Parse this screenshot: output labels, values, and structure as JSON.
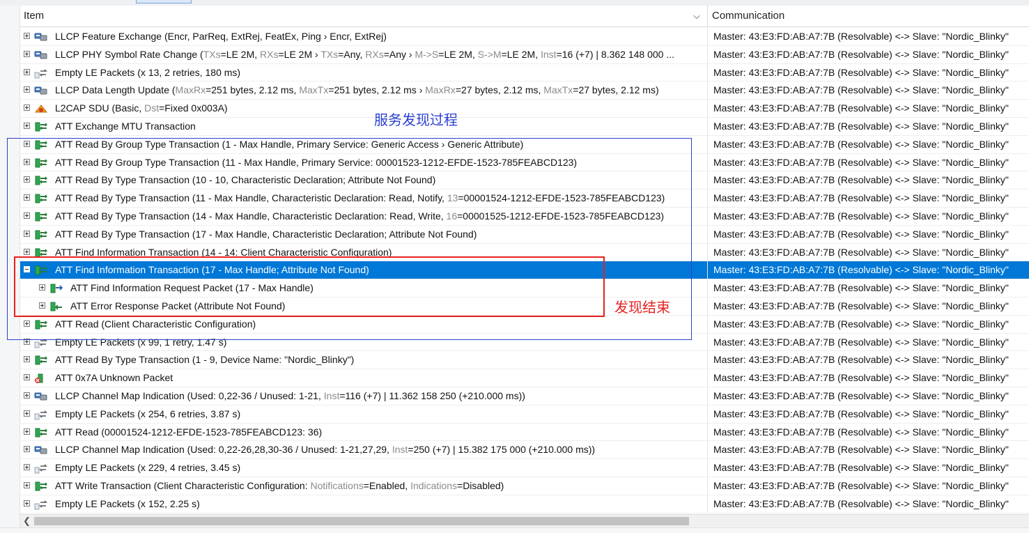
{
  "columns": {
    "item": "Item",
    "communication": "Communication"
  },
  "annotations": {
    "service_discovery": "服务发现过程",
    "discovery_end": "发现结束"
  },
  "colors": {
    "selection": "#0078d7",
    "annotation_blue": "#2a3fcf",
    "annotation_red": "#e52020"
  },
  "rows": [
    {
      "icon": "llcp-icon",
      "expander": "plus",
      "level": 0,
      "selected": false,
      "parts": [
        {
          "t": "LLCP Feature Exchange (Encr, ParReq, ExtRej, FeatEx, Ping › Encr, ExtRej)",
          "dim": false
        }
      ],
      "comm": "Master: 43:E3:FD:AB:A7:7B (Resolvable) <-> Slave: \"Nordic_Blinky\""
    },
    {
      "icon": "llcp-icon",
      "expander": "plus",
      "level": 0,
      "selected": false,
      "parts": [
        {
          "t": "LLCP PHY Symbol Rate Change (",
          "dim": false
        },
        {
          "t": "TXs",
          "dim": true
        },
        {
          "t": "=LE 2M, ",
          "dim": false
        },
        {
          "t": "RXs",
          "dim": true
        },
        {
          "t": "=LE 2M › ",
          "dim": false
        },
        {
          "t": "TXs",
          "dim": true
        },
        {
          "t": "=Any, ",
          "dim": false
        },
        {
          "t": "RXs",
          "dim": true
        },
        {
          "t": "=Any › ",
          "dim": false
        },
        {
          "t": "M->S",
          "dim": true
        },
        {
          "t": "=LE 2M, ",
          "dim": false
        },
        {
          "t": "S->M",
          "dim": true
        },
        {
          "t": "=LE 2M, ",
          "dim": false
        },
        {
          "t": "Inst",
          "dim": true
        },
        {
          "t": "=16 (+7) | 8.362 148 000 ...",
          "dim": false
        }
      ],
      "comm": "Master: 43:E3:FD:AB:A7:7B (Resolvable) <-> Slave: \"Nordic_Blinky\""
    },
    {
      "icon": "empty-packets-icon",
      "expander": "plus",
      "level": 0,
      "selected": false,
      "parts": [
        {
          "t": "Empty LE Packets (x 13, 2 retries, 180 ms)",
          "dim": false
        }
      ],
      "comm": "Master: 43:E3:FD:AB:A7:7B (Resolvable) <-> Slave: \"Nordic_Blinky\""
    },
    {
      "icon": "llcp-icon",
      "expander": "plus",
      "level": 0,
      "selected": false,
      "parts": [
        {
          "t": "LLCP Data Length Update (",
          "dim": false
        },
        {
          "t": "MaxRx",
          "dim": true
        },
        {
          "t": "=251 bytes, 2.12 ms, ",
          "dim": false
        },
        {
          "t": "MaxTx",
          "dim": true
        },
        {
          "t": "=251 bytes, 2.12 ms › ",
          "dim": false
        },
        {
          "t": "MaxRx",
          "dim": true
        },
        {
          "t": "=27 bytes, 2.12 ms, ",
          "dim": false
        },
        {
          "t": "MaxTx",
          "dim": true
        },
        {
          "t": "=27 bytes, 2.12 ms)",
          "dim": false
        }
      ],
      "comm": "Master: 43:E3:FD:AB:A7:7B (Resolvable) <-> Slave: \"Nordic_Blinky\""
    },
    {
      "icon": "l2cap-icon",
      "expander": "plus",
      "level": 0,
      "selected": false,
      "parts": [
        {
          "t": "L2CAP SDU (Basic, ",
          "dim": false
        },
        {
          "t": "Dst",
          "dim": true
        },
        {
          "t": "=Fixed 0x003A)",
          "dim": false
        }
      ],
      "comm": "Master: 43:E3:FD:AB:A7:7B (Resolvable) <-> Slave: \"Nordic_Blinky\""
    },
    {
      "icon": "att-transaction-icon",
      "expander": "plus",
      "level": 0,
      "selected": false,
      "parts": [
        {
          "t": "ATT Exchange MTU Transaction",
          "dim": false
        }
      ],
      "comm": "Master: 43:E3:FD:AB:A7:7B (Resolvable) <-> Slave: \"Nordic_Blinky\""
    },
    {
      "icon": "att-transaction-icon",
      "expander": "plus",
      "level": 0,
      "selected": false,
      "parts": [
        {
          "t": "ATT Read By Group Type Transaction (1 - Max Handle, Primary Service:  Generic Access › Generic Attribute)",
          "dim": false
        }
      ],
      "comm": "Master: 43:E3:FD:AB:A7:7B (Resolvable) <-> Slave: \"Nordic_Blinky\""
    },
    {
      "icon": "att-transaction-icon",
      "expander": "plus",
      "level": 0,
      "selected": false,
      "parts": [
        {
          "t": "ATT Read By Group Type Transaction (11 - Max Handle, Primary Service: 00001523-1212-EFDE-1523-785FEABCD123)",
          "dim": false
        }
      ],
      "comm": "Master: 43:E3:FD:AB:A7:7B (Resolvable) <-> Slave: \"Nordic_Blinky\""
    },
    {
      "icon": "att-transaction-icon",
      "expander": "plus",
      "level": 0,
      "selected": false,
      "parts": [
        {
          "t": "ATT Read By Type Transaction (10 - 10, Characteristic Declaration; Attribute Not Found)",
          "dim": false
        }
      ],
      "comm": "Master: 43:E3:FD:AB:A7:7B (Resolvable) <-> Slave: \"Nordic_Blinky\""
    },
    {
      "icon": "att-transaction-icon",
      "expander": "plus",
      "level": 0,
      "selected": false,
      "parts": [
        {
          "t": "ATT Read By Type Transaction (11 - Max Handle, Characteristic Declaration: Read, Notify, ",
          "dim": false
        },
        {
          "t": "13",
          "dim": true
        },
        {
          "t": "=00001524-1212-EFDE-1523-785FEABCD123)",
          "dim": false
        }
      ],
      "comm": "Master: 43:E3:FD:AB:A7:7B (Resolvable) <-> Slave: \"Nordic_Blinky\""
    },
    {
      "icon": "att-transaction-icon",
      "expander": "plus",
      "level": 0,
      "selected": false,
      "parts": [
        {
          "t": "ATT Read By Type Transaction (14 - Max Handle, Characteristic Declaration: Read, Write, ",
          "dim": false
        },
        {
          "t": "16",
          "dim": true
        },
        {
          "t": "=00001525-1212-EFDE-1523-785FEABCD123)",
          "dim": false
        }
      ],
      "comm": "Master: 43:E3:FD:AB:A7:7B (Resolvable) <-> Slave: \"Nordic_Blinky\""
    },
    {
      "icon": "att-transaction-icon",
      "expander": "plus",
      "level": 0,
      "selected": false,
      "parts": [
        {
          "t": "ATT Read By Type Transaction (17 - Max Handle, Characteristic Declaration; Attribute Not Found)",
          "dim": false
        }
      ],
      "comm": "Master: 43:E3:FD:AB:A7:7B (Resolvable) <-> Slave: \"Nordic_Blinky\""
    },
    {
      "icon": "att-transaction-icon",
      "expander": "plus",
      "level": 0,
      "selected": false,
      "parts": [
        {
          "t": "ATT Find Information Transaction (14 - 14: Client Characteristic Configuration)",
          "dim": false
        }
      ],
      "comm": "Master: 43:E3:FD:AB:A7:7B (Resolvable) <-> Slave: \"Nordic_Blinky\""
    },
    {
      "icon": "att-transaction-icon",
      "expander": "minus",
      "level": 0,
      "selected": true,
      "parts": [
        {
          "t": "ATT Find Information Transaction (17 - Max Handle; Attribute Not Found)",
          "dim": false
        }
      ],
      "comm": "Master: 43:E3:FD:AB:A7:7B (Resolvable) <-> Slave: \"Nordic_Blinky\""
    },
    {
      "icon": "att-request-icon",
      "expander": "plus",
      "level": 1,
      "selected": false,
      "parts": [
        {
          "t": "ATT Find Information Request Packet (17 - Max Handle)",
          "dim": false
        }
      ],
      "comm": "Master: 43:E3:FD:AB:A7:7B (Resolvable) <-> Slave: \"Nordic_Blinky\""
    },
    {
      "icon": "att-response-icon",
      "expander": "plus",
      "level": 1,
      "selected": false,
      "parts": [
        {
          "t": "ATT Error Response Packet (Attribute Not Found)",
          "dim": false
        }
      ],
      "comm": "Master: 43:E3:FD:AB:A7:7B (Resolvable) <-> Slave: \"Nordic_Blinky\""
    },
    {
      "icon": "att-transaction-icon",
      "expander": "plus",
      "level": 0,
      "selected": false,
      "parts": [
        {
          "t": "ATT Read (Client Characteristic Configuration)",
          "dim": false
        }
      ],
      "comm": "Master: 43:E3:FD:AB:A7:7B (Resolvable) <-> Slave: \"Nordic_Blinky\""
    },
    {
      "icon": "empty-packets-icon",
      "expander": "plus",
      "level": 0,
      "selected": false,
      "parts": [
        {
          "t": "Empty LE Packets (x 99, 1 retry, 1.47 s)",
          "dim": false
        }
      ],
      "comm": "Master: 43:E3:FD:AB:A7:7B (Resolvable) <-> Slave: \"Nordic_Blinky\""
    },
    {
      "icon": "att-transaction-icon",
      "expander": "plus",
      "level": 0,
      "selected": false,
      "parts": [
        {
          "t": "ATT Read By Type Transaction (1 - 9, Device Name: \"Nordic_Blinky\")",
          "dim": false
        }
      ],
      "comm": "Master: 43:E3:FD:AB:A7:7B (Resolvable) <-> Slave: \"Nordic_Blinky\""
    },
    {
      "icon": "att-unknown-icon",
      "expander": "plus",
      "level": 0,
      "selected": false,
      "parts": [
        {
          "t": "ATT 0x7A Unknown Packet",
          "dim": false
        }
      ],
      "comm": "Master: 43:E3:FD:AB:A7:7B (Resolvable) <-> Slave: \"Nordic_Blinky\""
    },
    {
      "icon": "llcp-icon",
      "expander": "plus",
      "level": 0,
      "selected": false,
      "parts": [
        {
          "t": "LLCP Channel Map Indication (Used: 0,22-36 / Unused: 1-21, ",
          "dim": false
        },
        {
          "t": "Inst",
          "dim": true
        },
        {
          "t": "=116 (+7) | 11.362 158 250 (+210.000 ms))",
          "dim": false
        }
      ],
      "comm": "Master: 43:E3:FD:AB:A7:7B (Resolvable) <-> Slave: \"Nordic_Blinky\""
    },
    {
      "icon": "empty-packets-icon",
      "expander": "plus",
      "level": 0,
      "selected": false,
      "parts": [
        {
          "t": "Empty LE Packets (x 254, 6 retries, 3.87 s)",
          "dim": false
        }
      ],
      "comm": "Master: 43:E3:FD:AB:A7:7B (Resolvable) <-> Slave: \"Nordic_Blinky\""
    },
    {
      "icon": "att-transaction-icon",
      "expander": "plus",
      "level": 0,
      "selected": false,
      "parts": [
        {
          "t": "ATT Read (00001524-1212-EFDE-1523-785FEABCD123: 36)",
          "dim": false
        }
      ],
      "comm": "Master: 43:E3:FD:AB:A7:7B (Resolvable) <-> Slave: \"Nordic_Blinky\""
    },
    {
      "icon": "llcp-icon",
      "expander": "plus",
      "level": 0,
      "selected": false,
      "parts": [
        {
          "t": "LLCP Channel Map Indication (Used: 0,22-26,28,30-36 / Unused: 1-21,27,29, ",
          "dim": false
        },
        {
          "t": "Inst",
          "dim": true
        },
        {
          "t": "=250 (+7) | 15.382 175 000 (+210.000 ms))",
          "dim": false
        }
      ],
      "comm": "Master: 43:E3:FD:AB:A7:7B (Resolvable) <-> Slave: \"Nordic_Blinky\""
    },
    {
      "icon": "empty-packets-icon",
      "expander": "plus",
      "level": 0,
      "selected": false,
      "parts": [
        {
          "t": "Empty LE Packets (x 229, 4 retries, 3.45 s)",
          "dim": false
        }
      ],
      "comm": "Master: 43:E3:FD:AB:A7:7B (Resolvable) <-> Slave: \"Nordic_Blinky\""
    },
    {
      "icon": "att-transaction-icon",
      "expander": "plus",
      "level": 0,
      "selected": false,
      "parts": [
        {
          "t": "ATT Write Transaction (Client Characteristic Configuration: ",
          "dim": false
        },
        {
          "t": "Notifications",
          "dim": true
        },
        {
          "t": "=Enabled, ",
          "dim": false
        },
        {
          "t": "Indications",
          "dim": true
        },
        {
          "t": "=Disabled)",
          "dim": false
        }
      ],
      "comm": "Master: 43:E3:FD:AB:A7:7B (Resolvable) <-> Slave: \"Nordic_Blinky\""
    },
    {
      "icon": "empty-packets-icon",
      "expander": "plus",
      "level": 0,
      "selected": false,
      "parts": [
        {
          "t": "Empty LE Packets (x 152, 2.25 s)",
          "dim": false
        }
      ],
      "comm": "Master: 43:E3:FD:AB:A7:7B (Resolvable) <-> Slave: \"Nordic_Blinky\""
    }
  ]
}
